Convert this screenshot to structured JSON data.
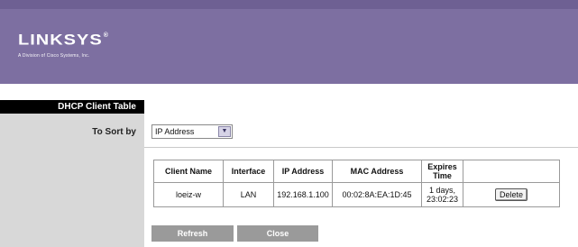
{
  "brand": {
    "name": "LINKSYS",
    "registered_mark": "®",
    "tagline": "A Division of Cisco Systems, Inc."
  },
  "sidebar": {
    "section_title": "DHCP Client Table",
    "sort_label": "To Sort by"
  },
  "sort": {
    "selected": "IP Address",
    "arrow_icon": "chevron-down-icon"
  },
  "table": {
    "headers": {
      "client_name": "Client Name",
      "interface": "Interface",
      "ip_address": "IP Address",
      "mac_address": "MAC Address",
      "expires_time": "Expires Time",
      "action": ""
    },
    "rows": [
      {
        "client_name": "loeiz-w",
        "interface": "LAN",
        "ip_address": "192.168.1.100",
        "mac_address": "00:02:8A:EA:1D:45",
        "expires_time": "1 days, 23:02:23",
        "action_label": "Delete"
      }
    ]
  },
  "buttons": {
    "refresh": "Refresh",
    "close": "Close"
  },
  "colors": {
    "header": "#7d6fa1",
    "sidebar": "#d8d8d8",
    "section_bar": "#000000",
    "button": "#9a9a9a"
  }
}
